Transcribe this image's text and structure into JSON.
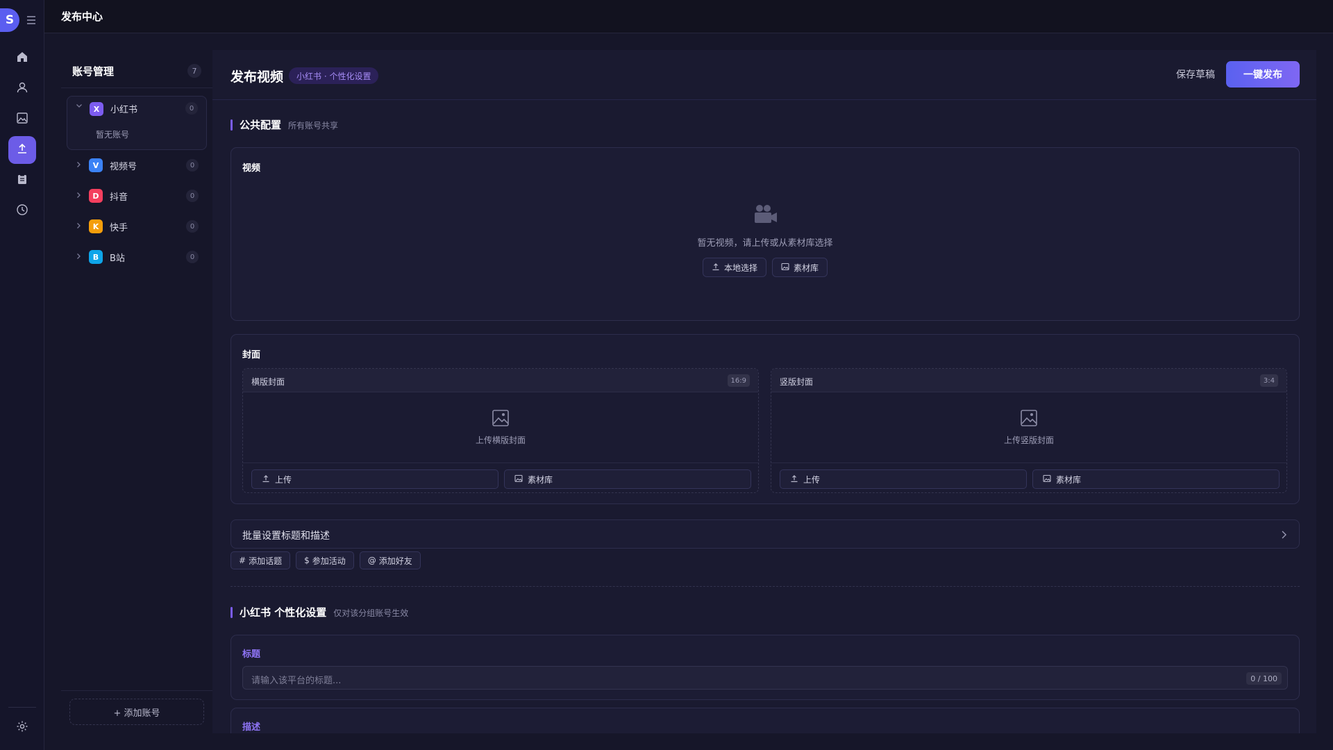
{
  "app": {
    "avatar_letter": "S",
    "page_title": "发布中心",
    "accent_color": "#6c5ce7"
  },
  "rail": {
    "items": [
      {
        "icon": "home-icon"
      },
      {
        "icon": "user-icon"
      },
      {
        "icon": "image-icon"
      },
      {
        "icon": "upload-icon",
        "active": true
      },
      {
        "icon": "clipboard-icon"
      },
      {
        "icon": "clock-icon"
      }
    ],
    "bottom_icon": "gear-icon"
  },
  "accounts": {
    "title": "账号管理",
    "count": "7",
    "platforms": [
      {
        "badge": "X",
        "name": "小红书",
        "count": "0",
        "color": "#7c5cf0",
        "expanded": true,
        "empty_text": "暂无账号"
      },
      {
        "badge": "V",
        "name": "视频号",
        "count": "0",
        "color": "#3b82f6"
      },
      {
        "badge": "D",
        "name": "抖音",
        "count": "0",
        "color": "#f43f5e"
      },
      {
        "badge": "K",
        "name": "快手",
        "count": "0",
        "color": "#f59e0b"
      },
      {
        "badge": "B",
        "name": "B站",
        "count": "0",
        "color": "#0ea5e9"
      }
    ],
    "add_button": "+ 添加账号"
  },
  "main": {
    "title": "发布视频",
    "tag": "小红书 · 个性化设置",
    "save_draft": "保存草稿",
    "publish": "一键发布",
    "common": {
      "title": "公共配置",
      "subtitle": "所有账号共享"
    },
    "video": {
      "label": "视频",
      "empty_text": "暂无视频，请上传或从素材库选择",
      "local_btn": "本地选择",
      "library_btn": "素材库"
    },
    "cover": {
      "label": "封面",
      "horizontal": {
        "label": "横版封面",
        "ratio": "16:9",
        "upload_text": "上传横版封面",
        "upload_btn": "上传",
        "library_btn": "素材库"
      },
      "vertical": {
        "label": "竖版封面",
        "ratio": "3:4",
        "upload_text": "上传竖版封面",
        "upload_btn": "上传",
        "library_btn": "素材库"
      }
    },
    "batch": {
      "text": "批量设置标题和描述",
      "chips": [
        {
          "prefix": "#",
          "label": "添加话题"
        },
        {
          "prefix": "$",
          "label": "参加活动"
        },
        {
          "prefix": "@",
          "label": "添加好友"
        }
      ]
    },
    "personal": {
      "title": "小红书 个性化设置",
      "subtitle": "仅对该分组账号生效",
      "title_field": {
        "label": "标题",
        "placeholder": "请输入该平台的标题...",
        "counter": "0 / 100"
      },
      "desc_field": {
        "label": "描述"
      }
    }
  }
}
